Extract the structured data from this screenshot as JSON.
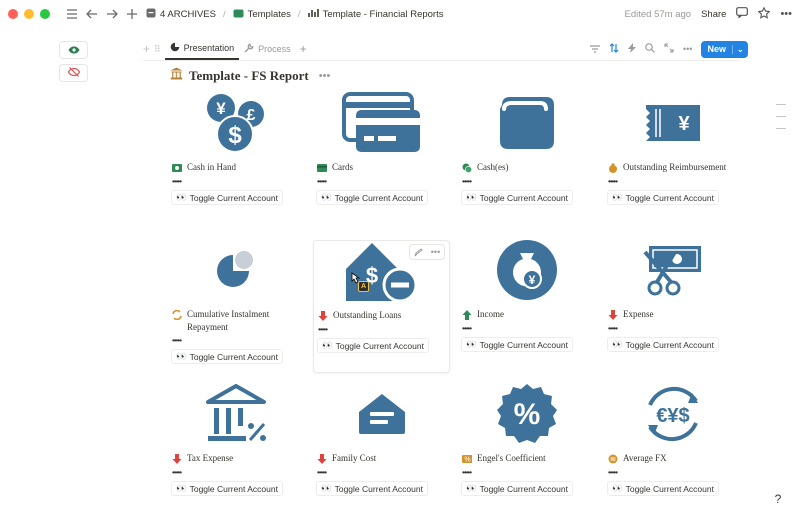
{
  "window": {
    "traffic": [
      "#ff5f57",
      "#febc2e",
      "#28c840"
    ]
  },
  "breadcrumb": {
    "workspace": "4 ARCHIVES",
    "templates": "Templates",
    "page": "Template - Financial Reports"
  },
  "topbar": {
    "edited": "Edited 57m ago",
    "share": "Share"
  },
  "tabs": [
    {
      "label": "Presentation",
      "active": true
    },
    {
      "label": "Process",
      "active": false
    }
  ],
  "new_button": {
    "label": "New"
  },
  "page_title": "Template - FS Report",
  "toggle_label": "Toggle Current Account",
  "dots_text": "•••••",
  "accent": "#3f729b",
  "cards": [
    {
      "name": "Cash in Hand",
      "icon": "money-icon"
    },
    {
      "name": "Cards",
      "icon": "credit-card-icon"
    },
    {
      "name": "Cash(es)",
      "icon": "coins-icon"
    },
    {
      "name": "Outstanding Reimbursement",
      "icon": "moneybag-icon"
    },
    {
      "name": "Cumulative Instalment Repayment",
      "icon": "repeat-icon"
    },
    {
      "name": "Outstanding Loans",
      "icon": "down-arrow-icon"
    },
    {
      "name": "Income",
      "icon": "up-arrow-icon"
    },
    {
      "name": "Expense",
      "icon": "down-arrow-icon"
    },
    {
      "name": "Tax Expense",
      "icon": "down-arrow-icon"
    },
    {
      "name": "Family Cost",
      "icon": "down-arrow-icon"
    },
    {
      "name": "Engel's Coefficient",
      "icon": "percent-icon"
    },
    {
      "name": "Average FX",
      "icon": "exchange-icon"
    }
  ]
}
